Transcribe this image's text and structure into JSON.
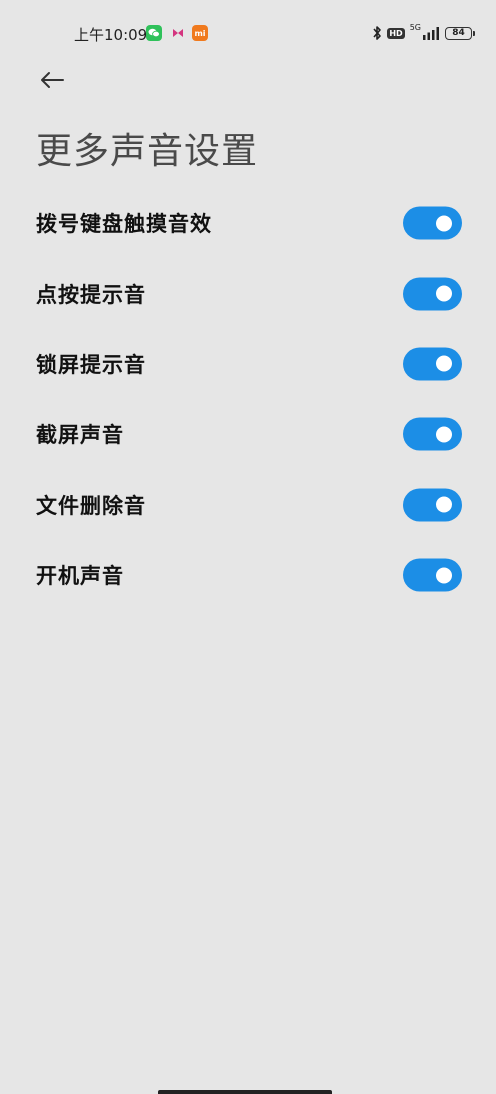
{
  "status_bar": {
    "time": "上午10:09",
    "notifications": [
      "wechat-icon",
      "mail-icon",
      "mi-icon"
    ],
    "mi_label": "mi",
    "hd_label": "HD",
    "network_label": "5G",
    "battery_level": "84"
  },
  "header": {
    "back_icon": "arrow-left-icon",
    "title": "更多声音设置"
  },
  "settings": [
    {
      "label": "拨号键盘触摸音效",
      "enabled": true
    },
    {
      "label": "点按提示音",
      "enabled": true
    },
    {
      "label": "锁屏提示音",
      "enabled": true
    },
    {
      "label": "截屏声音",
      "enabled": true
    },
    {
      "label": "文件删除音",
      "enabled": true
    },
    {
      "label": "开机声音",
      "enabled": true
    }
  ],
  "colors": {
    "background": "#e6e6e6",
    "toggle_on": "#1c8ee6",
    "toggle_knob": "#ffffff",
    "title_text": "#4a4a4a",
    "label_text": "#111111"
  }
}
